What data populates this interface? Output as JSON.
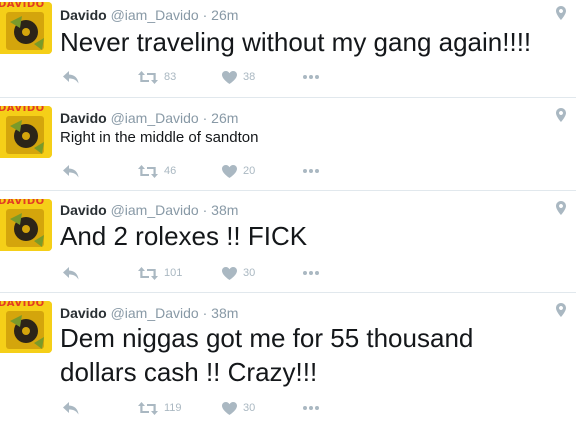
{
  "colors": {
    "text": "#14171a",
    "name": "#292f33",
    "meta": "#8899a6",
    "icon": "#aab8c2",
    "divider": "#e1e8ed",
    "avatar_bg": "#f5cf18",
    "avatar_text": "#e23a24"
  },
  "tweets": [
    {
      "avatar_text": "DAVIDO",
      "name": "Davido",
      "handle": "@iam_Davido",
      "separator": "·",
      "time": "26m",
      "text": "Never traveling without my gang again!!!!",
      "retweets": "83",
      "likes": "38"
    },
    {
      "avatar_text": "DAVIDO",
      "name": "Davido",
      "handle": "@iam_Davido",
      "separator": "·",
      "time": "26m",
      "text": "Right in the middle of sandton",
      "retweets": "46",
      "likes": "20"
    },
    {
      "avatar_text": "DAVIDO",
      "name": "Davido",
      "handle": "@iam_Davido",
      "separator": "·",
      "time": "38m",
      "text": "And 2 rolexes !! FICK",
      "retweets": "101",
      "likes": "30"
    },
    {
      "avatar_text": "DAVIDO",
      "name": "Davido",
      "handle": "@iam_Davido",
      "separator": "·",
      "time": "38m",
      "text": "Dem niggas got me for 55 thousand dollars cash !! Crazy!!!",
      "retweets": "119",
      "likes": "30"
    }
  ],
  "icons": {
    "reply": "reply-icon",
    "retweet": "retweet-icon",
    "like": "heart-icon",
    "more": "more-icon",
    "location": "location-pin-icon"
  }
}
